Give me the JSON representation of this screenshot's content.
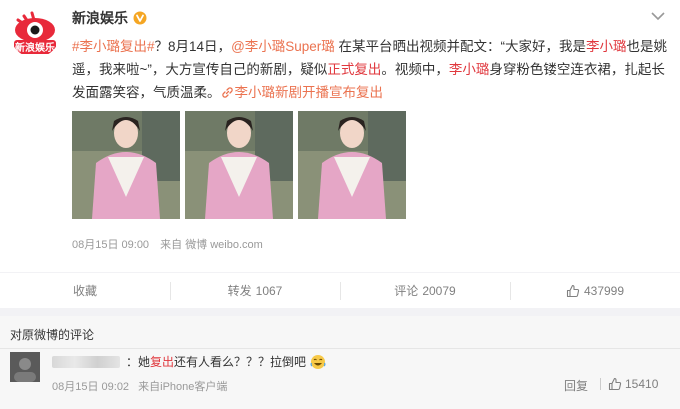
{
  "post": {
    "author": "新浪娱乐",
    "text": {
      "tag1": "#李小璐复出#",
      "t1": "？8月14日，",
      "at": "@李小璐Super璐",
      "t2": " 在某平台晒出视频并配文：“大家好，我是",
      "name1": "李小璐",
      "t3": "也是姚遥，我来啦~”，大方宣传自己的新剧，疑似",
      "kw": "正式复出",
      "t4": "。视频中，",
      "name2": "李小璐",
      "t5": "身穿粉色镂空连衣裙，扎起长发面露笑容，气质温柔。",
      "tag2": "李小璐新剧开播宣布复出"
    },
    "time": "08月15日 09:00",
    "source_prefix": "来自",
    "source": "微博 weibo.com"
  },
  "actions": {
    "collect": "收藏",
    "repost_label": "转发",
    "repost_count": "1067",
    "comment_label": "评论",
    "comment_count": "20079",
    "like_count": "437999"
  },
  "comments": {
    "title": "对原微博的评论",
    "items": [
      {
        "sep": "：",
        "t1": "她",
        "kw": "复出",
        "t2": "还有人看么？？？拉倒吧",
        "time": "08月15日 09:02",
        "source": "来自iPhone客户端",
        "reply": "回复",
        "likes": "15410"
      }
    ]
  },
  "colors": {
    "accent": "#eb7350",
    "keyword": "#e0383e",
    "verified": "#f5a623"
  },
  "icons": [
    "weibo-eye-logo",
    "verified-v-icon",
    "chevron-down-icon",
    "link-icon",
    "thumbs-up-icon",
    "laughing-emoji-icon"
  ]
}
